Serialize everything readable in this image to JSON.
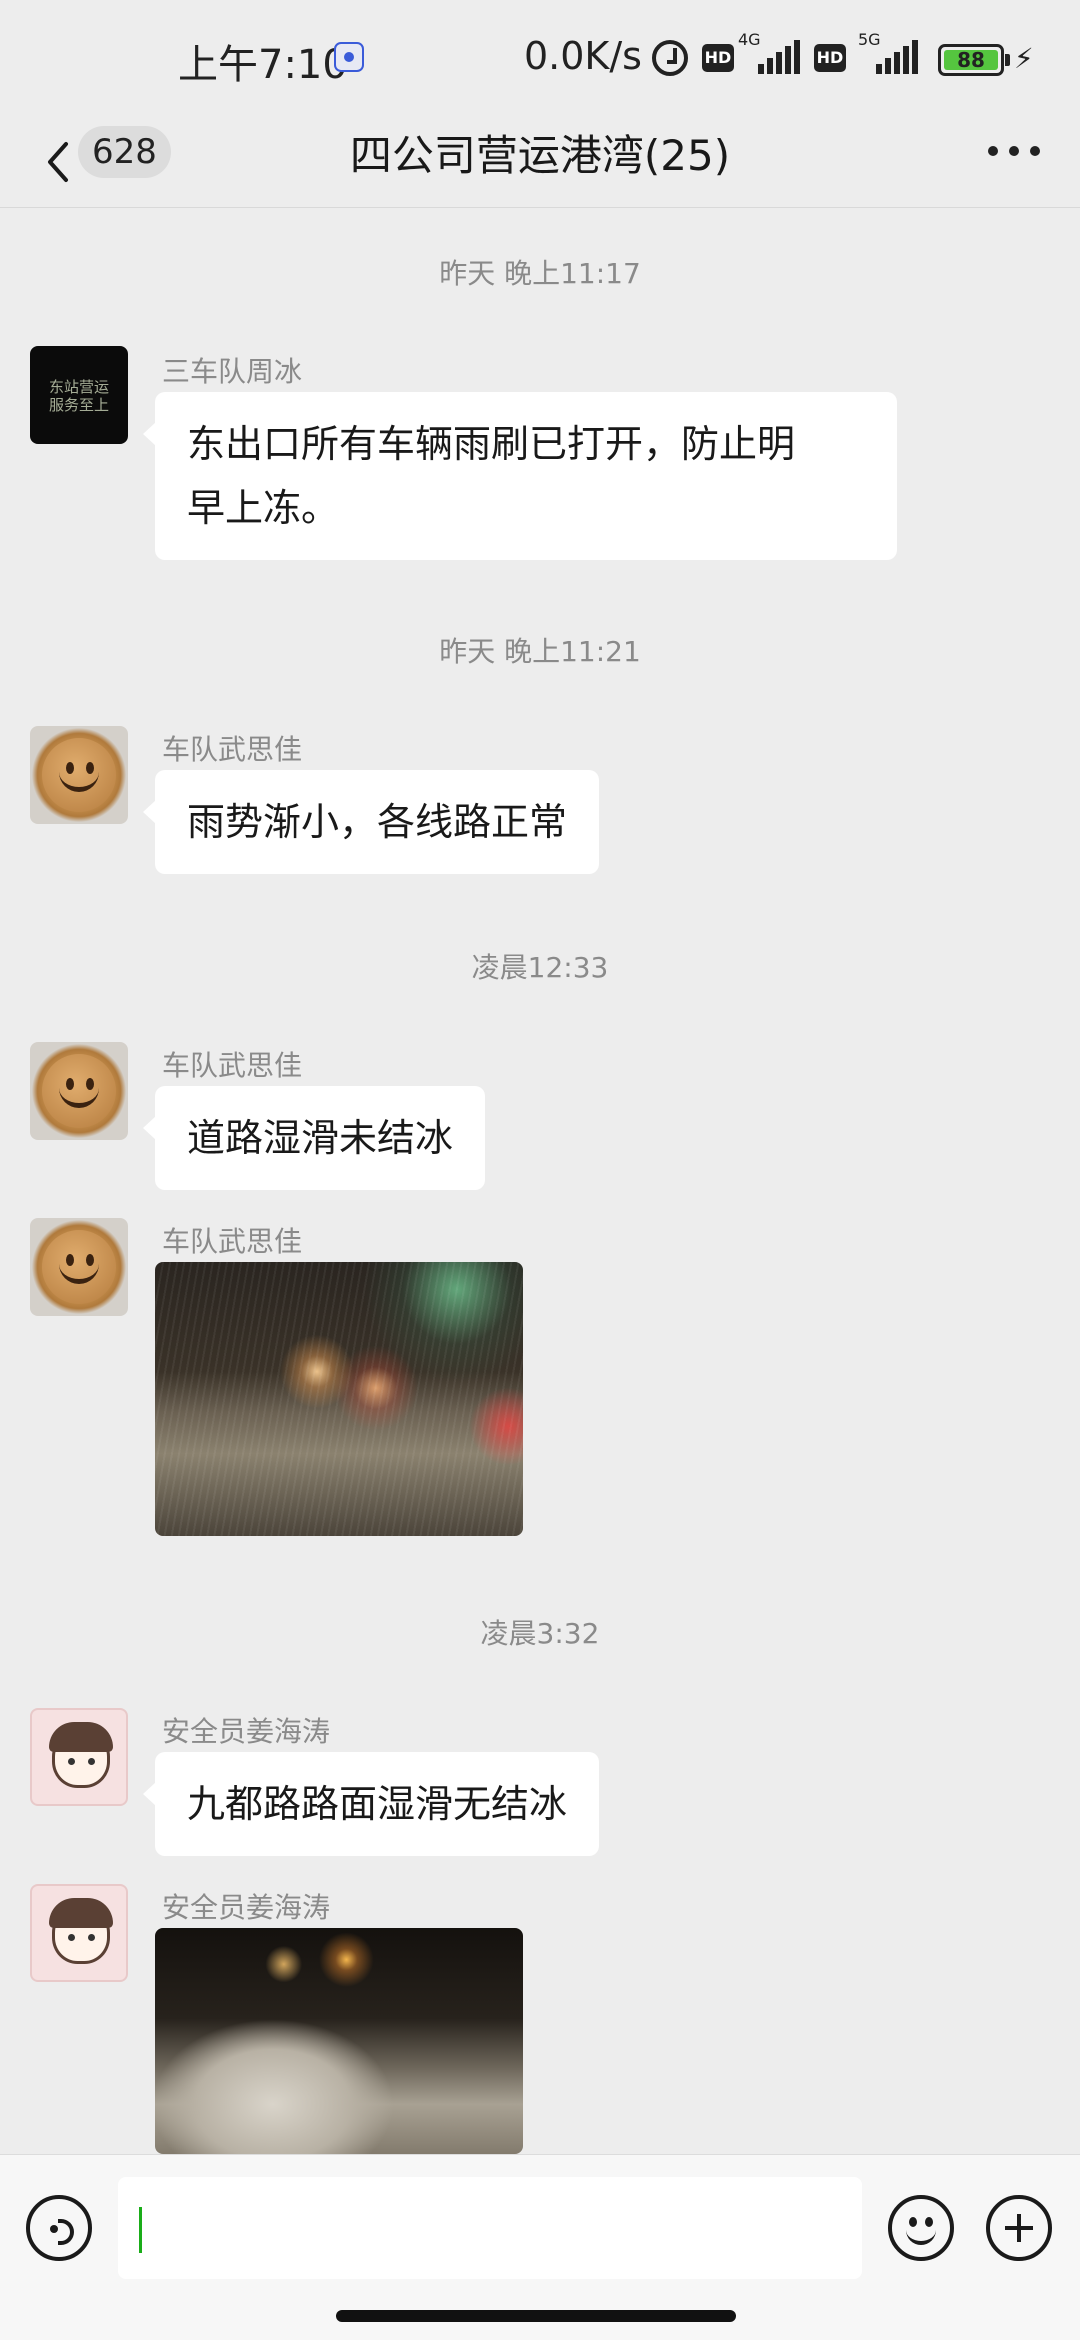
{
  "status_bar": {
    "time": "上午7:10",
    "net_speed": "0.0K/s",
    "hd1": "HD",
    "net1": "4G",
    "hd2": "HD",
    "net2": "5G",
    "battery": "88",
    "icons": [
      "baidu-icon",
      "alarm-icon",
      "signal-icon",
      "battery-icon",
      "charging-icon"
    ]
  },
  "nav": {
    "unread_count": "628",
    "title": "四公司营运港湾(25)",
    "icons": [
      "back-icon",
      "more-icon"
    ]
  },
  "messages": {
    "ts1": "昨天 晚上11:17",
    "m1_sender": "三车队周冰",
    "m1_avatar_text": "东站营运 服务至上",
    "m1_text_line1": "东出口所有车辆雨刷已打开，防止明",
    "m1_text_line2": "早上冻。",
    "ts2": "昨天 晚上11:21",
    "m2_sender": "车队武思佳",
    "m2_text": "雨势渐小，各线路正常",
    "ts3": "凌晨12:33",
    "m3_sender": "车队武思佳",
    "m3_text": "道路湿滑未结冰",
    "m4_sender": "车队武思佳",
    "m4_image": "rainy-night-road-photo",
    "ts4": "凌晨3:32",
    "m5_sender": "安全员姜海涛",
    "m5_text": "九都路路面湿滑无结冰",
    "m6_sender": "安全员姜海涛",
    "m6_image": "snowy-night-road-photo"
  },
  "input_bar": {
    "value": "",
    "icons": [
      "voice-icon",
      "emoji-icon",
      "plus-icon"
    ]
  },
  "colors": {
    "background": "#ededed",
    "bubble": "#ffffff",
    "caret": "#1aad19",
    "meta_text": "#8a8a8a"
  }
}
